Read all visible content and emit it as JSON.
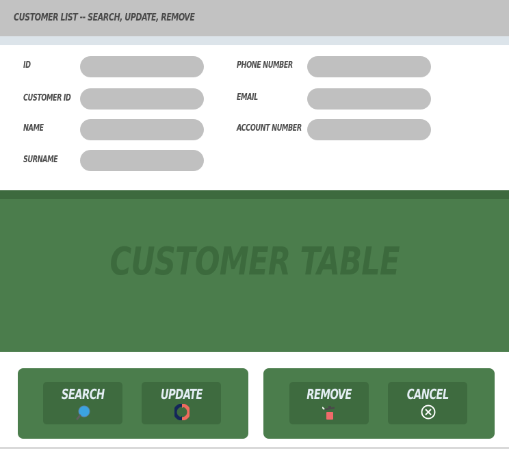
{
  "window": {
    "title": "CUSTOMER LIST -- SEARCH, UPDATE, REMOVE"
  },
  "form": {
    "fields": [
      {
        "label": "ID",
        "value": ""
      },
      {
        "label": "CUSTOMER ID",
        "value": ""
      },
      {
        "label": "NAME",
        "value": ""
      },
      {
        "label": "SURNAME",
        "value": ""
      },
      {
        "label": "PHONE NUMBER",
        "value": ""
      },
      {
        "label": "EMAIL",
        "value": ""
      },
      {
        "label": "ACCOUNT NUMBER",
        "value": ""
      }
    ]
  },
  "table": {
    "placeholder": "CUSTOMER TABLE"
  },
  "actions": {
    "search": {
      "label": "SEARCH",
      "icon": "magnifier-icon"
    },
    "update": {
      "label": "UPDATE",
      "icon": "refresh-icon"
    },
    "remove": {
      "label": "REMOVE",
      "icon": "trash-icon"
    },
    "cancel": {
      "label": "CANCEL",
      "icon": "close-circle-icon"
    }
  },
  "colors": {
    "title_bar": "#c2c2c2",
    "field": "#c0c0c0",
    "panel_green": "#4b7d4c",
    "button_green": "#3e6b3f",
    "button_text": "#e4eef4"
  }
}
